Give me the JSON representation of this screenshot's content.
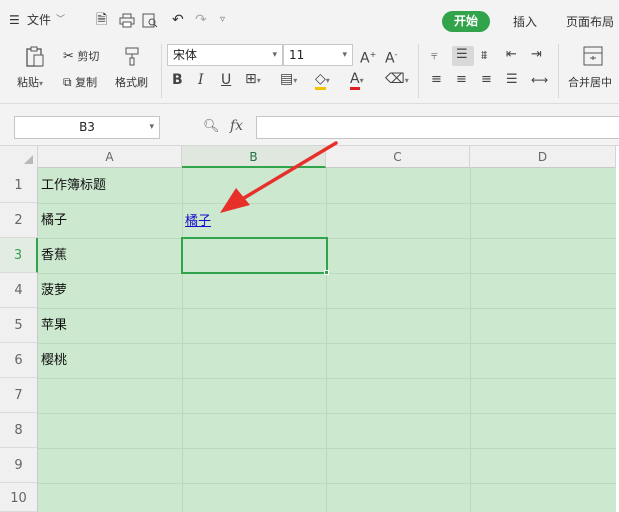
{
  "menubar": {
    "file_label": "文件",
    "tabs": {
      "home": "开始",
      "insert": "插入",
      "page_layout": "页面布局"
    }
  },
  "ribbon": {
    "paste": "粘贴",
    "cut": "剪切",
    "copy": "复制",
    "format_painter": "格式刷",
    "font_name": "宋体",
    "font_size": "11",
    "merge_center": "合并居中"
  },
  "formula_bar": {
    "name_box": "B3",
    "fx_label": "fx",
    "formula_value": ""
  },
  "sheet": {
    "columns": [
      "A",
      "B",
      "C",
      "D"
    ],
    "selected_column": "B",
    "rows": [
      "1",
      "2",
      "3",
      "4",
      "5",
      "6",
      "7",
      "8",
      "9",
      "10"
    ],
    "selected_row": "3",
    "column_a": [
      "工作簿标题",
      "橘子",
      "香蕉",
      "菠萝",
      "苹果",
      "樱桃"
    ],
    "b2_link": "橘子",
    "selected_cell": "B3"
  },
  "colors": {
    "accent": "#31a34b",
    "cell_fill": "#cce8cf",
    "link": "#1a0dcc",
    "annotation_arrow": "#e8302a"
  }
}
